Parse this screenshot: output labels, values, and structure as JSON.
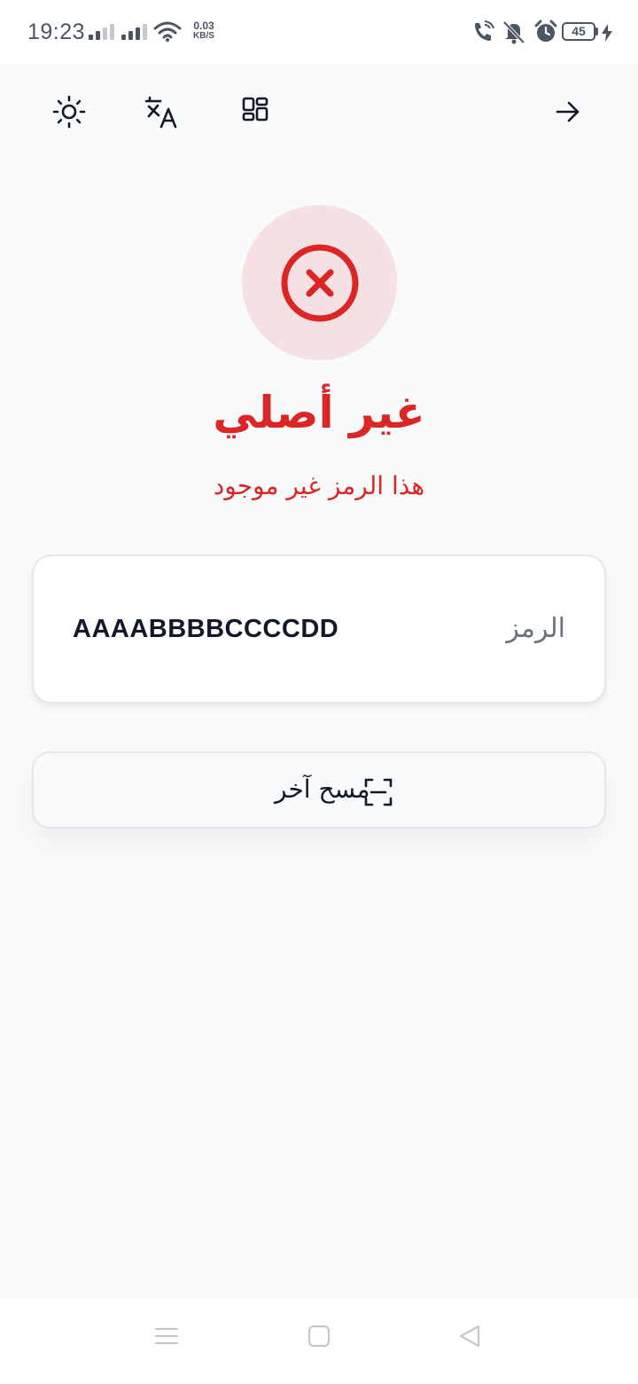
{
  "status_bar": {
    "time": "19:23",
    "net_speed_value": "0.03",
    "net_speed_unit": "KB/S",
    "battery_level": "45",
    "icons": [
      "signal-icon",
      "signal-icon",
      "wifi-icon",
      "wifi-call-icon",
      "vibrate-off-icon",
      "alarm-icon",
      "battery-icon",
      "charging-icon"
    ]
  },
  "toolbar": {
    "icons": [
      "theme-sun-icon",
      "translate-icon",
      "grid-menu-icon",
      "forward-arrow-icon"
    ]
  },
  "result": {
    "icon": "error-x-circle-icon",
    "title": "غير أصلي",
    "subtitle": "هذا الرمز غير موجود",
    "color": "#dc2626"
  },
  "code_card": {
    "label": "الرمز",
    "value": "AAAABBBBCCCCDD"
  },
  "scan_button": {
    "label": "مسح آخر",
    "icon": "scan-frame-icon"
  },
  "nav_bar": {
    "icons": [
      "menu-icon",
      "home-square-icon",
      "back-triangle-icon"
    ]
  }
}
